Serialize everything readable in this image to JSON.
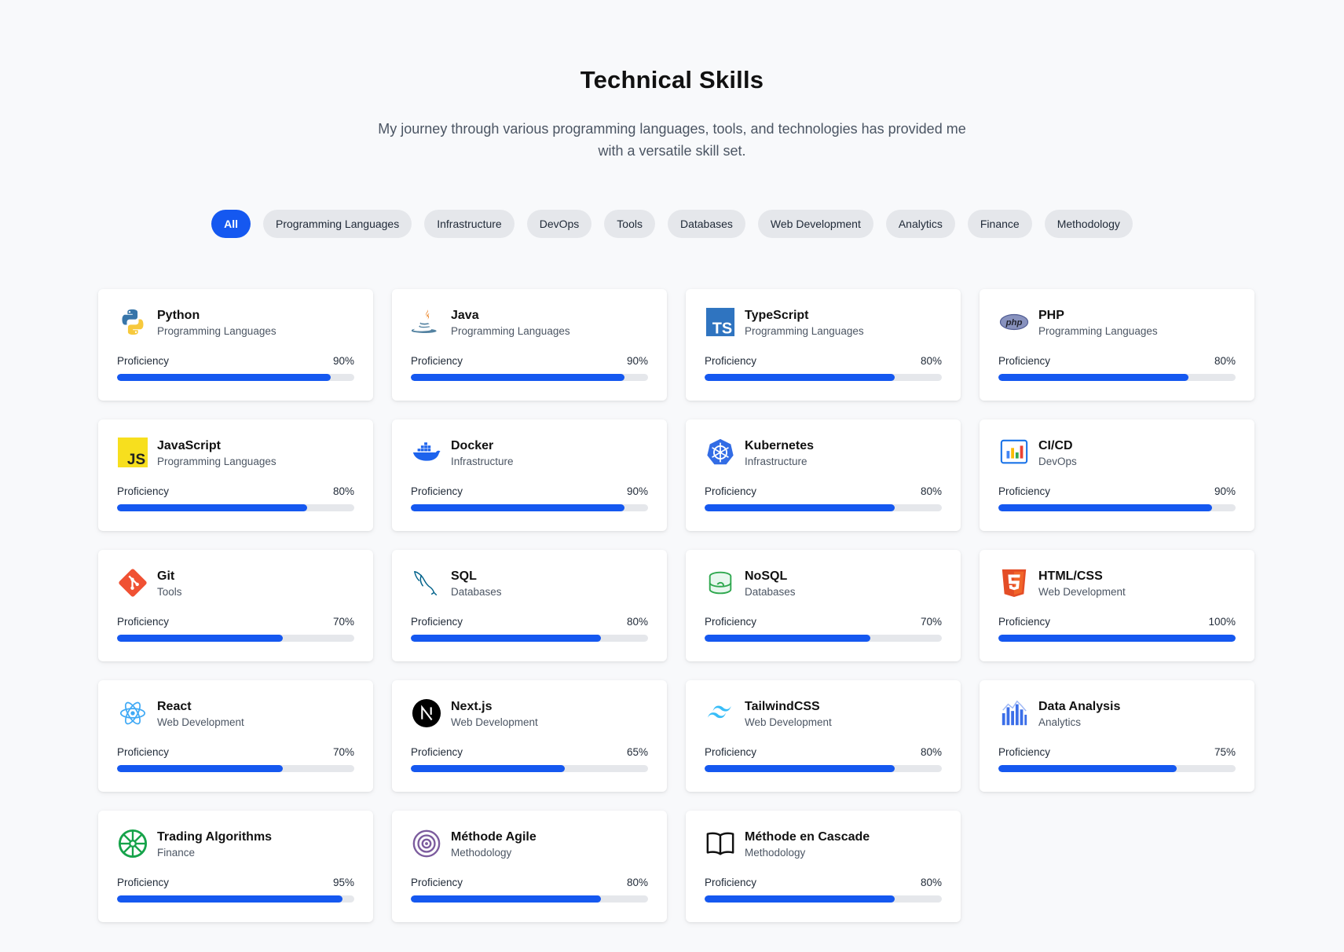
{
  "header": {
    "title": "Technical Skills",
    "subtitle": "My journey through various programming languages, tools, and technologies has provided me with a versatile skill set."
  },
  "filters": [
    "All",
    "Programming Languages",
    "Infrastructure",
    "DevOps",
    "Tools",
    "Databases",
    "Web Development",
    "Analytics",
    "Finance",
    "Methodology"
  ],
  "active_filter": "All",
  "proficiency_label": "Proficiency",
  "colors": {
    "accent": "#1558f0",
    "track": "#e5e7eb",
    "background": "#f8f9fb"
  },
  "skills": [
    {
      "name": "Python",
      "category": "Programming Languages",
      "percent": 90,
      "icon": "python-icon"
    },
    {
      "name": "Java",
      "category": "Programming Languages",
      "percent": 90,
      "icon": "java-icon"
    },
    {
      "name": "TypeScript",
      "category": "Programming Languages",
      "percent": 80,
      "icon": "typescript-icon"
    },
    {
      "name": "PHP",
      "category": "Programming Languages",
      "percent": 80,
      "icon": "php-icon"
    },
    {
      "name": "JavaScript",
      "category": "Programming Languages",
      "percent": 80,
      "icon": "javascript-icon"
    },
    {
      "name": "Docker",
      "category": "Infrastructure",
      "percent": 90,
      "icon": "docker-icon"
    },
    {
      "name": "Kubernetes",
      "category": "Infrastructure",
      "percent": 80,
      "icon": "kubernetes-icon"
    },
    {
      "name": "CI/CD",
      "category": "DevOps",
      "percent": 90,
      "icon": "cicd-chart-icon"
    },
    {
      "name": "Git",
      "category": "Tools",
      "percent": 70,
      "icon": "git-icon"
    },
    {
      "name": "SQL",
      "category": "Databases",
      "percent": 80,
      "icon": "mysql-dolphin-icon"
    },
    {
      "name": "NoSQL",
      "category": "Databases",
      "percent": 70,
      "icon": "nosql-database-icon"
    },
    {
      "name": "HTML/CSS",
      "category": "Web Development",
      "percent": 100,
      "icon": "html5-icon"
    },
    {
      "name": "React",
      "category": "Web Development",
      "percent": 70,
      "icon": "react-icon"
    },
    {
      "name": "Next.js",
      "category": "Web Development",
      "percent": 65,
      "icon": "nextjs-icon"
    },
    {
      "name": "TailwindCSS",
      "category": "Web Development",
      "percent": 80,
      "icon": "tailwind-icon"
    },
    {
      "name": "Data Analysis",
      "category": "Analytics",
      "percent": 75,
      "icon": "data-analysis-icon"
    },
    {
      "name": "Trading Algorithms",
      "category": "Finance",
      "percent": 95,
      "icon": "trading-wheel-icon"
    },
    {
      "name": "Méthode Agile",
      "category": "Methodology",
      "percent": 80,
      "icon": "agile-cycle-icon"
    },
    {
      "name": "Méthode en Cascade",
      "category": "Methodology",
      "percent": 80,
      "icon": "open-book-icon"
    }
  ]
}
